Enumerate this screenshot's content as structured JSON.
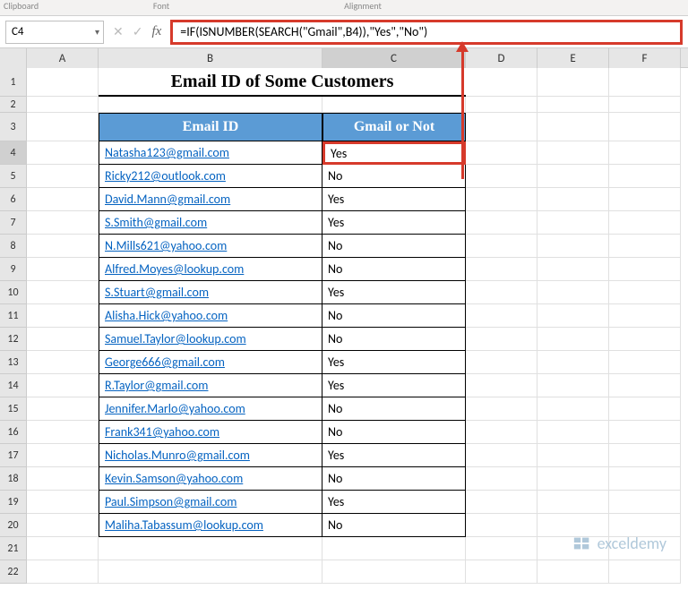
{
  "ribbon_hints": {
    "clipboard": "Clipboard",
    "font": "Font",
    "alignment": "Alignment"
  },
  "name_box": "C4",
  "formula": "=IF(ISNUMBER(SEARCH(\"Gmail\",B4)),\"Yes\",\"No\")",
  "columns": [
    "A",
    "B",
    "C",
    "D",
    "E",
    "F"
  ],
  "title": "Email ID of Some Customers",
  "headers": {
    "email": "Email ID",
    "gmail": "Gmail or Not"
  },
  "rows": [
    {
      "n": "1"
    },
    {
      "n": "2"
    },
    {
      "n": "3"
    },
    {
      "n": "4"
    },
    {
      "n": "5"
    },
    {
      "n": "6"
    },
    {
      "n": "7"
    },
    {
      "n": "8"
    },
    {
      "n": "9"
    },
    {
      "n": "10"
    },
    {
      "n": "11"
    },
    {
      "n": "12"
    },
    {
      "n": "13"
    },
    {
      "n": "14"
    },
    {
      "n": "15"
    },
    {
      "n": "16"
    },
    {
      "n": "17"
    },
    {
      "n": "18"
    },
    {
      "n": "19"
    },
    {
      "n": "20"
    },
    {
      "n": "21"
    },
    {
      "n": "22"
    }
  ],
  "data": [
    {
      "email": "Natasha123@gmail.com",
      "gmail": "Yes"
    },
    {
      "email": "Ricky212@outlook.com",
      "gmail": "No"
    },
    {
      "email": "David.Mann@gmail.com",
      "gmail": "Yes"
    },
    {
      "email": "S.Smith@gmail.com",
      "gmail": "Yes"
    },
    {
      "email": "N.Mills621@yahoo.com",
      "gmail": "No"
    },
    {
      "email": "Alfred.Moyes@lookup.com",
      "gmail": "No"
    },
    {
      "email": "S.Stuart@gmail.com",
      "gmail": "Yes"
    },
    {
      "email": "Alisha.Hick@yahoo.com",
      "gmail": "No"
    },
    {
      "email": "Samuel.Taylor@lookup.com",
      "gmail": "No"
    },
    {
      "email": "George666@gmail.com",
      "gmail": "Yes"
    },
    {
      "email": "R.Taylor@gmail.com",
      "gmail": "Yes"
    },
    {
      "email": "Jennifer.Marlo@yahoo.com",
      "gmail": "No"
    },
    {
      "email": "Frank341@yahoo.com",
      "gmail": "No"
    },
    {
      "email": "Nicholas.Munro@gmail.com",
      "gmail": "Yes"
    },
    {
      "email": "Kevin.Samson@yahoo.com",
      "gmail": "No"
    },
    {
      "email": "Paul.Simpson@gmail.com",
      "gmail": "Yes"
    },
    {
      "email": "Maliha.Tabassum@lookup.com",
      "gmail": "No"
    }
  ],
  "watermark": "exceldemy"
}
